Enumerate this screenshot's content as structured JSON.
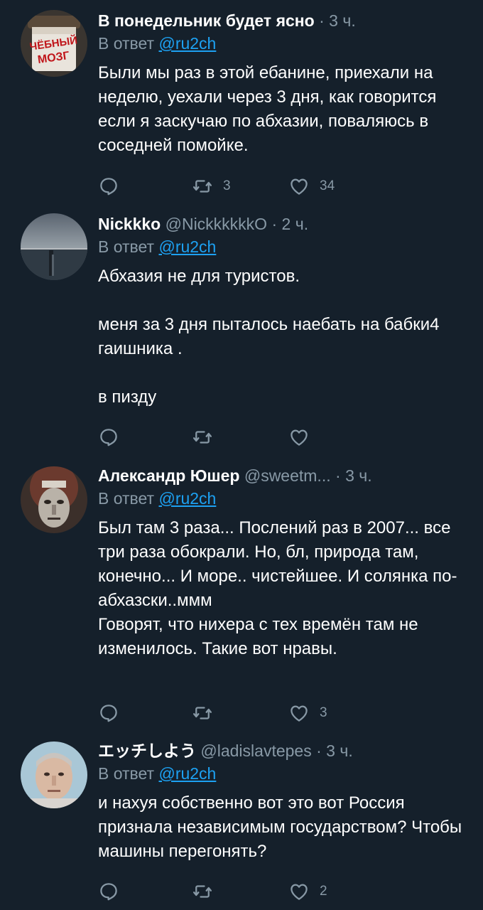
{
  "colors": {
    "background": "#15202b",
    "muted": "#8899a6",
    "link": "#1da1f2",
    "text": "#ffffff"
  },
  "tweets": [
    {
      "name": "В понедельник будет ясно",
      "handle": "",
      "time": "3 ч.",
      "reply_label": "В ответ",
      "reply_to": "@ru2ch",
      "text": "Были мы раз в этой ебанине, приехали на неделю, уехали через 3 дня, как говорится если я заскучаю по абхазии, поваляюсь в соседней помойке.",
      "retweets": "3",
      "likes": "34",
      "avatar_caption": "ЧЁБНЫЙ МОЗГ",
      "avatar_icon": "jar-photo"
    },
    {
      "name": "Nickkko",
      "handle": "@NickkkkkkO",
      "time": "2 ч.",
      "reply_label": "В ответ",
      "reply_to": "@ru2ch",
      "text": "Абхазия не для туристов.\n\nменя за 3 дня пыталось наебать на бабки4 гаишника .\n\nв пизду",
      "retweets": "",
      "likes": "",
      "avatar_icon": "sea-photo"
    },
    {
      "name": "Александр Юшер",
      "handle": "@sweetm...",
      "time": "3 ч.",
      "reply_label": "В ответ",
      "reply_to": "@ru2ch",
      "text": "Был там 3 раза... Послений раз в 2007... все три раза обокрали. Но, бл, природа там, конечно... И море.. чистейшее. И солянка по-абхазски..ммм\nГоворят, что нихера с тех времён там не изменилось. Такие вот нравы.",
      "retweets": "",
      "likes": "3",
      "avatar_icon": "face-art"
    },
    {
      "name": "エッチしよう",
      "handle": "@ladislavtepes",
      "time": "3 ч.",
      "reply_label": "В ответ",
      "reply_to": "@ru2ch",
      "text": "и нахуя собственно вот это вот Россия признала независимым государством? Чтобы машины перегонять?",
      "retweets": "",
      "likes": "2",
      "avatar_icon": "man-portrait"
    }
  ]
}
